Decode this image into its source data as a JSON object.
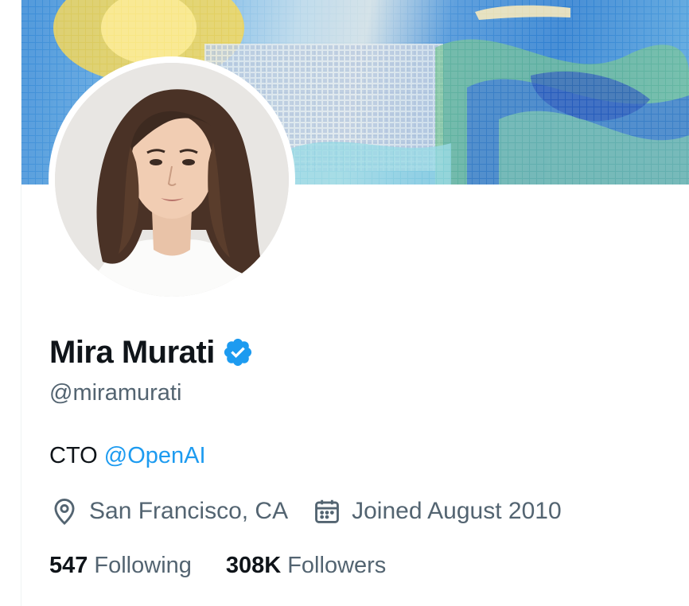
{
  "profile": {
    "display_name": "Mira Murati",
    "handle": "@miramurati",
    "bio_prefix": "CTO ",
    "bio_link": "@OpenAI",
    "location": "San Francisco, CA",
    "joined": "Joined August 2010",
    "following_count": "547",
    "following_label": "Following",
    "followers_count": "308K",
    "followers_label": "Followers"
  },
  "icons": {
    "verified": "verified-badge-icon",
    "location": "location-pin-icon",
    "joined": "calendar-icon"
  },
  "colors": {
    "text_primary": "#0f1419",
    "text_secondary": "#536471",
    "link": "#1d9bf0",
    "verified": "#1d9bf0"
  }
}
